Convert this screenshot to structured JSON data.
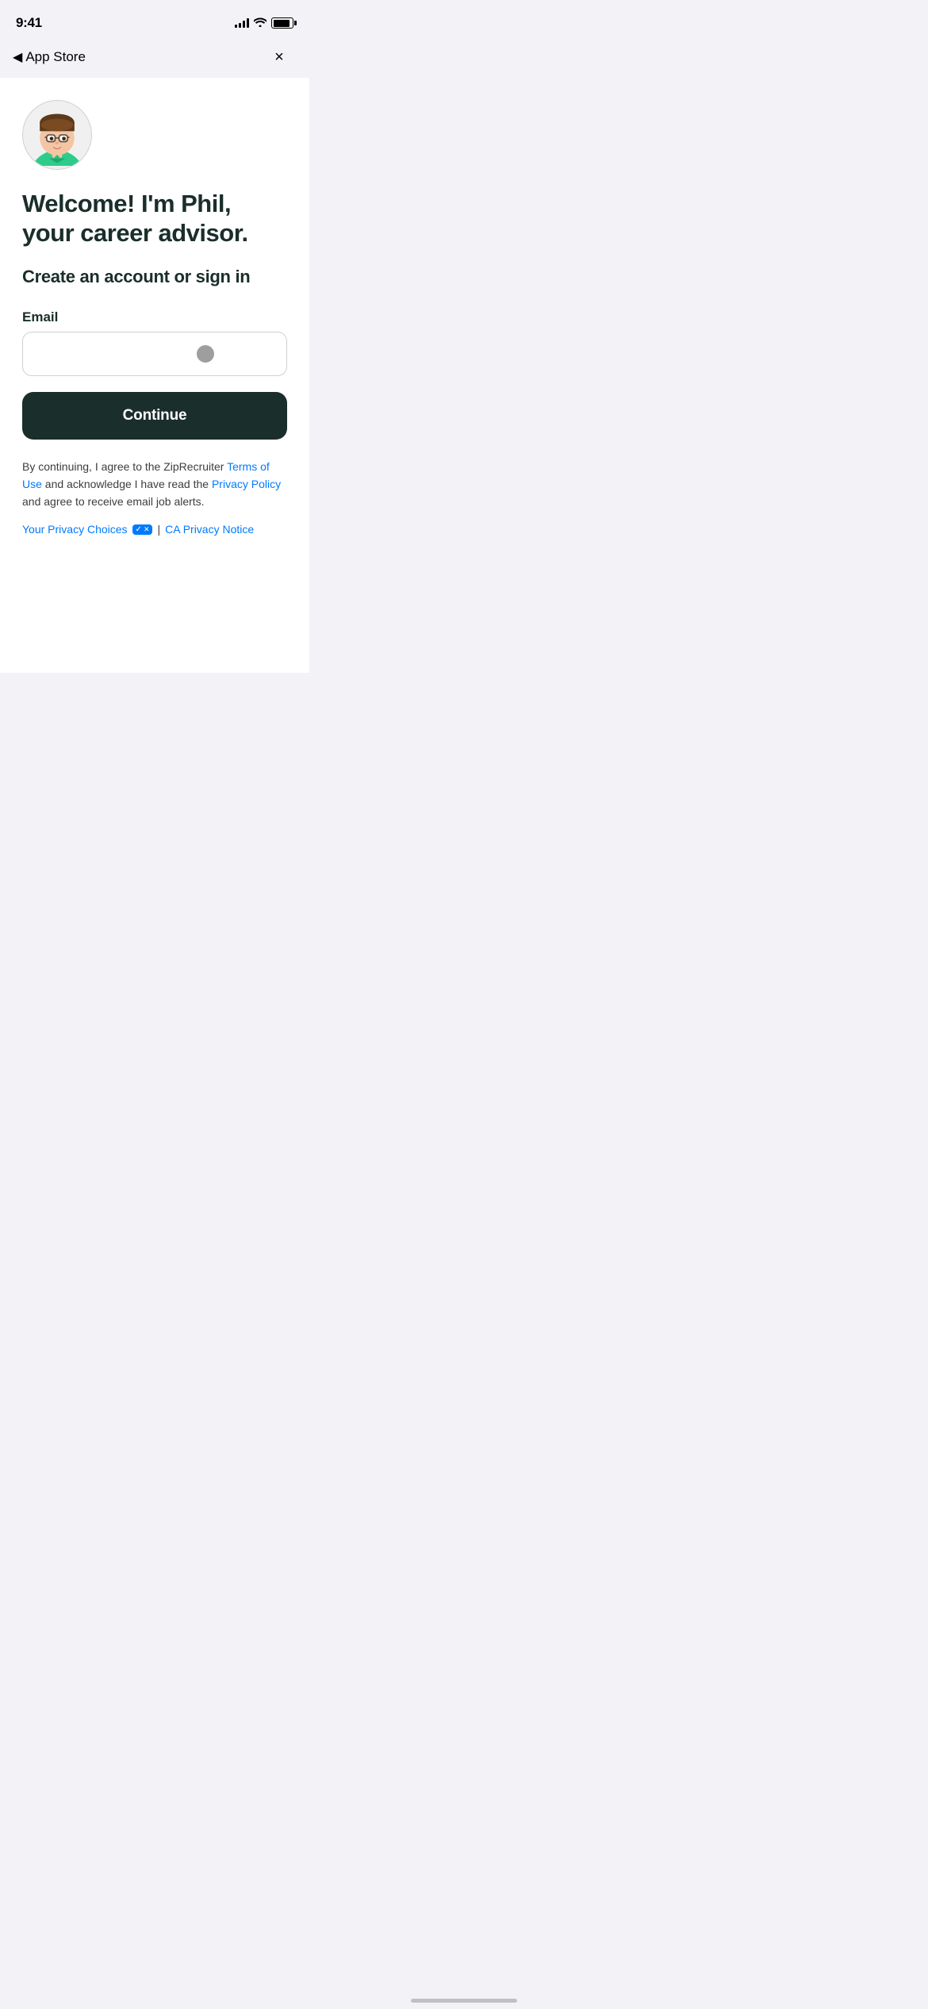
{
  "status_bar": {
    "time": "9:41",
    "back_label": "App Store"
  },
  "header": {
    "close_label": "×"
  },
  "main": {
    "welcome_title": "Welcome! I'm Phil, your career advisor.",
    "subtitle": "Create an account or sign in",
    "email_label": "Email",
    "email_placeholder": "",
    "continue_button_label": "Continue",
    "legal_text_prefix": "By continuing, I agree to the ZipRecruiter ",
    "legal_terms_link": "Terms of Use",
    "legal_text_middle": " and acknowledge I have read the ",
    "legal_privacy_link": "Privacy Policy",
    "legal_text_suffix": " and agree to receive email job alerts.",
    "privacy_choices_label": "Your Privacy Choices",
    "privacy_divider": "|",
    "ca_privacy_label": "CA Privacy Notice"
  },
  "colors": {
    "brand_dark": "#1a2e2b",
    "link_blue": "#007aff",
    "text_dark": "#3d3d3d"
  }
}
